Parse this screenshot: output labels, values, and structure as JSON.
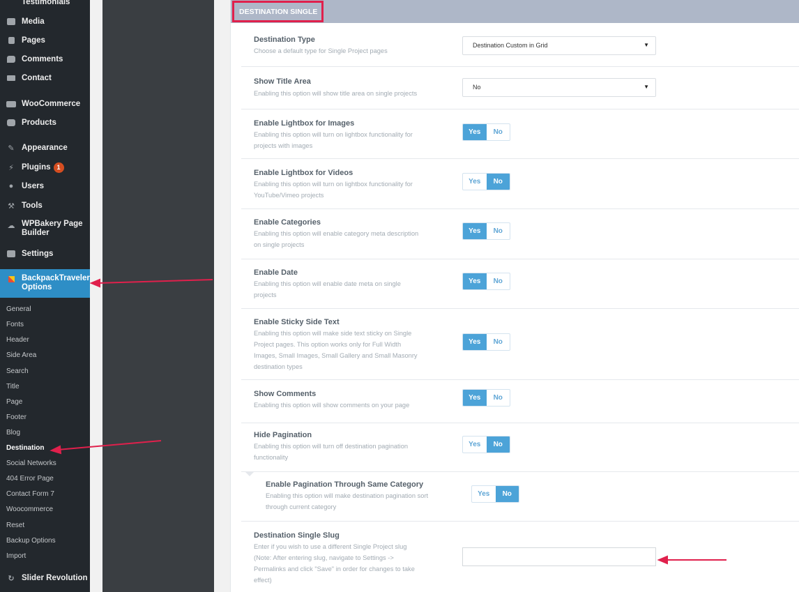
{
  "sidebar": {
    "menu": [
      {
        "label": "Testimonials",
        "icon": "testimonials-icon"
      },
      {
        "label": "Media",
        "icon": "media-icon"
      },
      {
        "label": "Pages",
        "icon": "pages-icon"
      },
      {
        "label": "Comments",
        "icon": "comments-icon"
      },
      {
        "label": "Contact",
        "icon": "mail-icon"
      },
      {
        "label": "WooCommerce",
        "icon": "woocommerce-icon"
      },
      {
        "label": "Products",
        "icon": "products-icon"
      },
      {
        "label": "Appearance",
        "icon": "appearance-icon"
      },
      {
        "label": "Plugins",
        "icon": "plugins-icon",
        "badge": "1"
      },
      {
        "label": "Users",
        "icon": "users-icon"
      },
      {
        "label": "Tools",
        "icon": "tools-icon"
      },
      {
        "label": "WPBakery Page",
        "label2": "Builder",
        "icon": "wpbakery-icon"
      },
      {
        "label": "Settings",
        "icon": "settings-icon"
      },
      {
        "label": "BackpackTraveler",
        "label2": "Options",
        "icon": "backpacktraveler-icon"
      }
    ],
    "submenu": [
      "General",
      "Fonts",
      "Header",
      "Side Area",
      "Search",
      "Title",
      "Page",
      "Footer",
      "Blog",
      "Destination",
      "Social Networks",
      "404 Error Page",
      "Contact Form 7",
      "Woocommerce",
      "Reset",
      "Backup Options",
      "Import"
    ],
    "current_sub": "Destination",
    "bottom": {
      "label": "Slider Revolution",
      "icon": "slider-revolution-icon"
    }
  },
  "section": {
    "title": "DESTINATION SINGLE"
  },
  "settings": {
    "destination_type": {
      "label": "Destination Type",
      "desc": "Choose a default type for Single Project pages",
      "value": "Destination Custom in Grid"
    },
    "show_title_area": {
      "label": "Show Title Area",
      "desc": "Enabling this option will show title area on single projects",
      "value": "No"
    },
    "lightbox_images": {
      "label": "Enable Lightbox for Images",
      "desc1": "Enabling this option will turn on lightbox functionality for",
      "desc2": "projects with images",
      "value": "Yes"
    },
    "lightbox_videos": {
      "label": "Enable Lightbox for Videos",
      "desc1": "Enabling this option will turn on lightbox functionality for",
      "desc2": "YouTube/Vimeo projects",
      "value": "No"
    },
    "categories": {
      "label": "Enable Categories",
      "desc1": "Enabling this option will enable category meta description",
      "desc2": "on single projects",
      "value": "Yes"
    },
    "date": {
      "label": "Enable Date",
      "desc1": "Enabling this option will enable date meta on single",
      "desc2": "projects",
      "value": "Yes"
    },
    "sticky_side_text": {
      "label": "Enable Sticky Side Text",
      "desc1": "Enabling this option will make side text sticky on Single",
      "desc2": "Project pages. This option works only for Full Width",
      "desc3": "Images, Small Images, Small Gallery and Small Masonry",
      "desc4": "destination types",
      "value": "Yes"
    },
    "show_comments": {
      "label": "Show Comments",
      "desc": "Enabling this option will show comments on your page",
      "value": "Yes"
    },
    "hide_pagination": {
      "label": "Hide Pagination",
      "desc1": "Enabling this option will turn off destination pagination",
      "desc2": "functionality",
      "value": "No"
    },
    "pagination_same_category": {
      "label": "Enable Pagination Through Same Category",
      "desc1": "Enabling this option will make destination pagination sort",
      "desc2": "through current category",
      "value": "No"
    },
    "single_slug": {
      "label": "Destination Single Slug",
      "desc1": "Enter if you wish to use a different Single Project slug",
      "desc2": "(Note: After entering slug, navigate to Settings ->",
      "desc3": "Permalinks and click \"Save\" in order for changes to take",
      "desc4": "effect)",
      "value": ""
    }
  },
  "toggle": {
    "yes": "Yes",
    "no": "No"
  },
  "colors": {
    "sidebar_bg": "#23282d",
    "active_bg": "#2e8ec6",
    "toggle_on": "#4ca3d8",
    "annotation": "#e0204c",
    "header_bg": "#aeb7c8"
  }
}
